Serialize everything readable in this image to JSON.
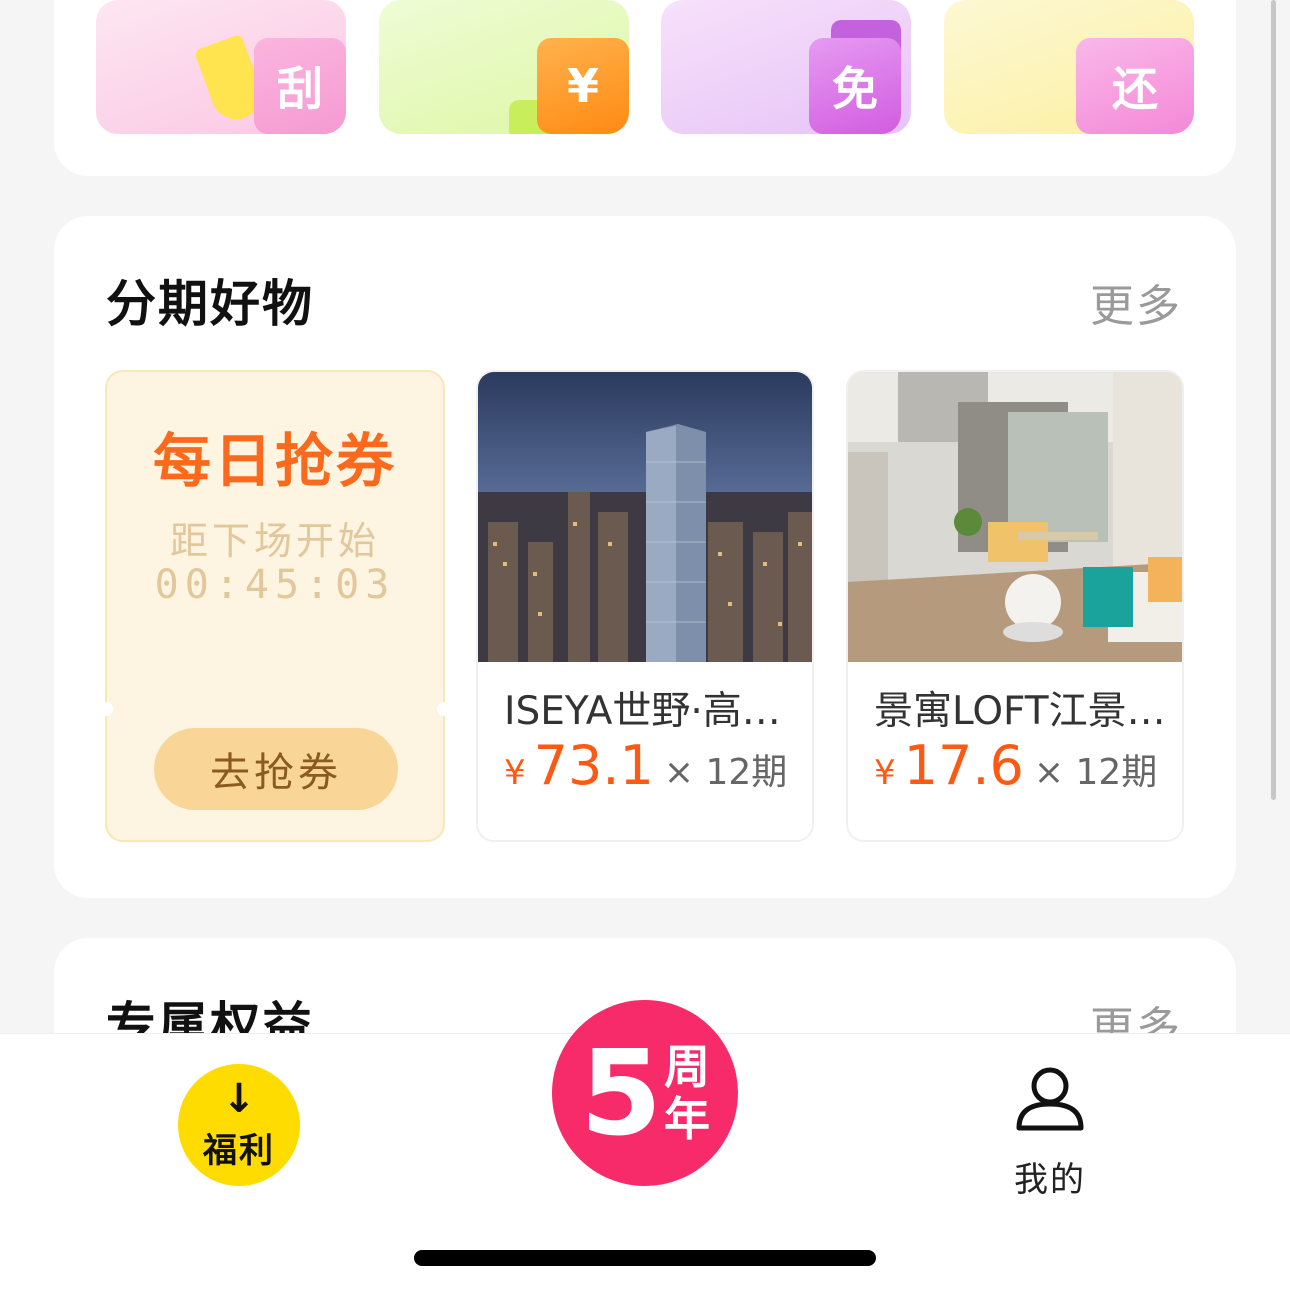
{
  "quick_entries": [
    {
      "label": "刮",
      "color": "#f59ad2"
    },
    {
      "label": "¥",
      "color": "#ff8a12"
    },
    {
      "label": "免",
      "color": "#d25ce0"
    },
    {
      "label": "还",
      "color": "#f488d8"
    }
  ],
  "installment_section": {
    "title": "分期好物",
    "more": "更多",
    "coupon": {
      "title": "每日抢券",
      "subtitle": "距下场开始",
      "timer": "00:45:03",
      "button": "去抢券"
    },
    "products": [
      {
        "name": "ISEYA世野·高…",
        "currency": "¥",
        "price": "73.1",
        "period": "× 12期"
      },
      {
        "name": "景寓LOFT江景…",
        "currency": "¥",
        "price": "17.6",
        "period": "× 12期"
      }
    ]
  },
  "rights_section": {
    "title": "专属权益",
    "more": "更多"
  },
  "tabbar": {
    "welfare_label": "福利",
    "anniversary_number": "5",
    "anniversary_text_top": "周",
    "anniversary_text_bottom": "年",
    "mine_label": "我的"
  },
  "colors": {
    "accent_orange": "#fb5a14",
    "anniversary_pink": "#f72b6a",
    "welfare_yellow": "#ffdc00"
  }
}
